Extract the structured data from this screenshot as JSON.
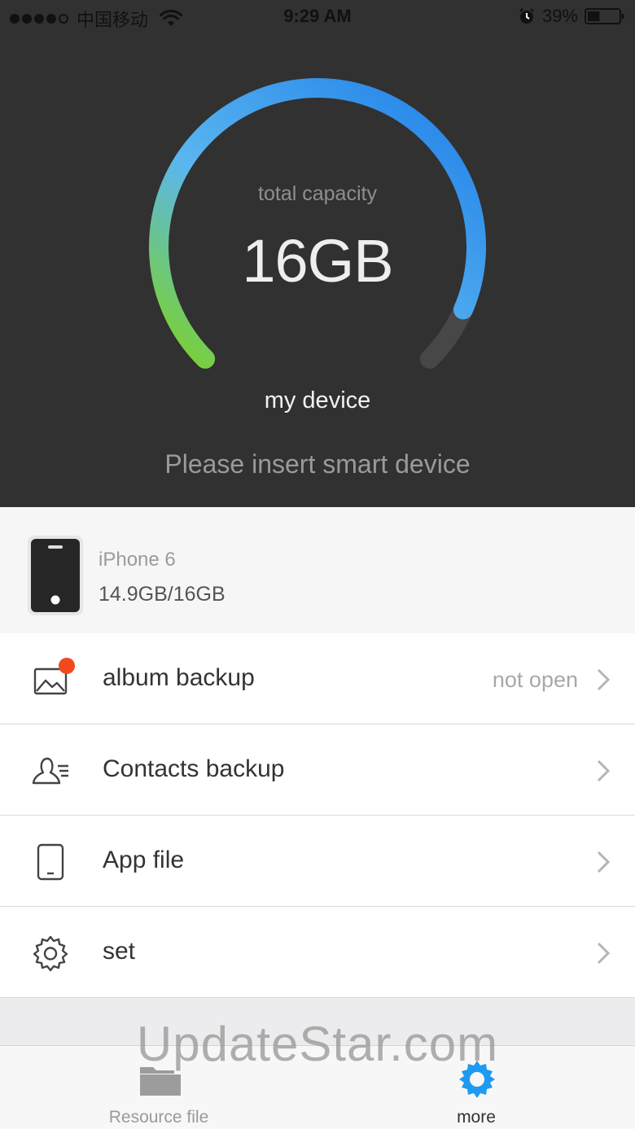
{
  "status_bar": {
    "carrier": "中国移动",
    "time": "9:29 AM",
    "battery_percent": "39%",
    "signal_dots_filled": 4,
    "signal_dots_total": 5,
    "battery_level": 0.39
  },
  "hero": {
    "gauge_label": "total capacity",
    "gauge_value": "16GB",
    "device_label": "my device",
    "message": "Please insert smart device",
    "gauge_fill_fraction": 0.92,
    "gradient_colors": [
      "#7ed321",
      "#5ab6f0",
      "#1f7fe8"
    ],
    "track_color": "#474747",
    "background": "#313131"
  },
  "device": {
    "name": "iPhone 6",
    "usage": "14.9GB/16GB",
    "icon": "phone-icon"
  },
  "menu": {
    "items": [
      {
        "label": "album backup",
        "status": "not open",
        "icon": "photo-icon",
        "has_badge": true
      },
      {
        "label": "Contacts backup",
        "status": "",
        "icon": "contacts-icon",
        "has_badge": false
      },
      {
        "label": "App file",
        "status": "",
        "icon": "tablet-icon",
        "has_badge": false
      },
      {
        "label": "set",
        "status": "",
        "icon": "gear-icon",
        "has_badge": false
      }
    ]
  },
  "tabbar": {
    "tabs": [
      {
        "label": "Resource file",
        "icon": "folder-icon",
        "active": false
      },
      {
        "label": "more",
        "icon": "gear-icon",
        "active": true
      }
    ],
    "active_color": "#1e9bf0",
    "inactive_color": "#9a9a9a"
  },
  "watermark": "UpdateStar.com"
}
